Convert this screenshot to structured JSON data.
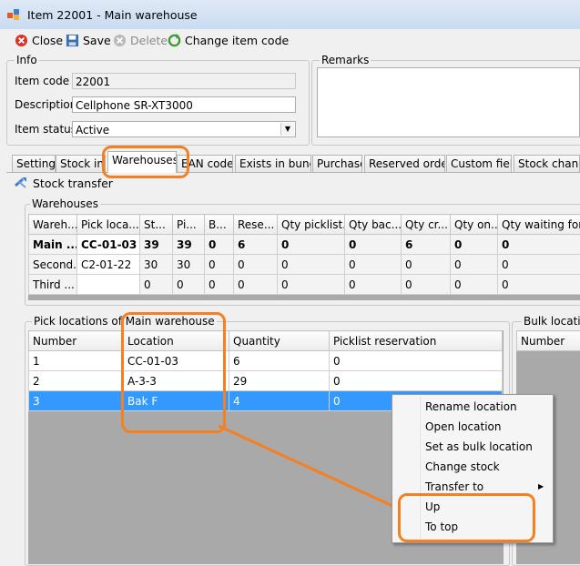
{
  "window": {
    "title": "Item 22001 - Main warehouse"
  },
  "toolbar": {
    "close": "Close",
    "save": "Save",
    "delete": "Delete",
    "change_item_code": "Change item code"
  },
  "info": {
    "group_label": "Info",
    "item_code_label": "Item code",
    "item_code_value": "22001",
    "description_label": "Description",
    "description_value": "Cellphone SR-XT3000",
    "item_status_label": "Item status",
    "item_status_value": "Active"
  },
  "remarks": {
    "group_label": "Remarks"
  },
  "tabs": [
    {
      "label": "Settings"
    },
    {
      "label": "Stock info"
    },
    {
      "label": "Warehouses"
    },
    {
      "label": "EAN codes"
    },
    {
      "label": "Exists in bundle"
    },
    {
      "label": "Purchase"
    },
    {
      "label": "Reserved orders"
    },
    {
      "label": "Custom fields"
    },
    {
      "label": "Stock change"
    }
  ],
  "stock_transfer": {
    "label": "Stock transfer"
  },
  "warehouses": {
    "group_label": "Warehouses",
    "columns": [
      "Wareh...",
      "Pick loca...",
      "St...",
      "Pi...",
      "B...",
      "Rese...",
      "Qty picklist...",
      "Qty bac...",
      "Qty cr...",
      "Qty on...",
      "Qty waiting for..."
    ],
    "rows": [
      [
        "Main ...",
        "CC-01-03",
        "39",
        "39",
        "0",
        "6",
        "0",
        "0",
        "6",
        "0",
        "0"
      ],
      [
        "Second...",
        "C2-01-22",
        "30",
        "30",
        "0",
        "0",
        "0",
        "0",
        "0",
        "0",
        "0"
      ],
      [
        "Third ...",
        "",
        "0",
        "0",
        "0",
        "0",
        "0",
        "0",
        "0",
        "0",
        "0"
      ]
    ]
  },
  "pick_locations": {
    "group_label": "Pick locations of Main warehouse",
    "columns": [
      "Number",
      "Location",
      "Quantity",
      "Picklist reservation"
    ],
    "rows": [
      [
        "1",
        "CC-01-03",
        "6",
        "0"
      ],
      [
        "2",
        "A-3-3",
        "29",
        "0"
      ],
      [
        "3",
        "Bak F",
        "4",
        "0"
      ]
    ]
  },
  "bulk_location": {
    "group_label": "Bulk location",
    "columns": [
      "Number"
    ]
  },
  "context_menu": {
    "items": [
      {
        "label": "Rename location"
      },
      {
        "label": "Open location"
      },
      {
        "label": "Set as bulk location"
      },
      {
        "label": "Change stock"
      },
      {
        "label": "Transfer to"
      },
      {
        "label": "Up"
      },
      {
        "label": "To top"
      }
    ]
  },
  "colors": {
    "highlight": "#f48021",
    "selection": "#3399ff"
  }
}
